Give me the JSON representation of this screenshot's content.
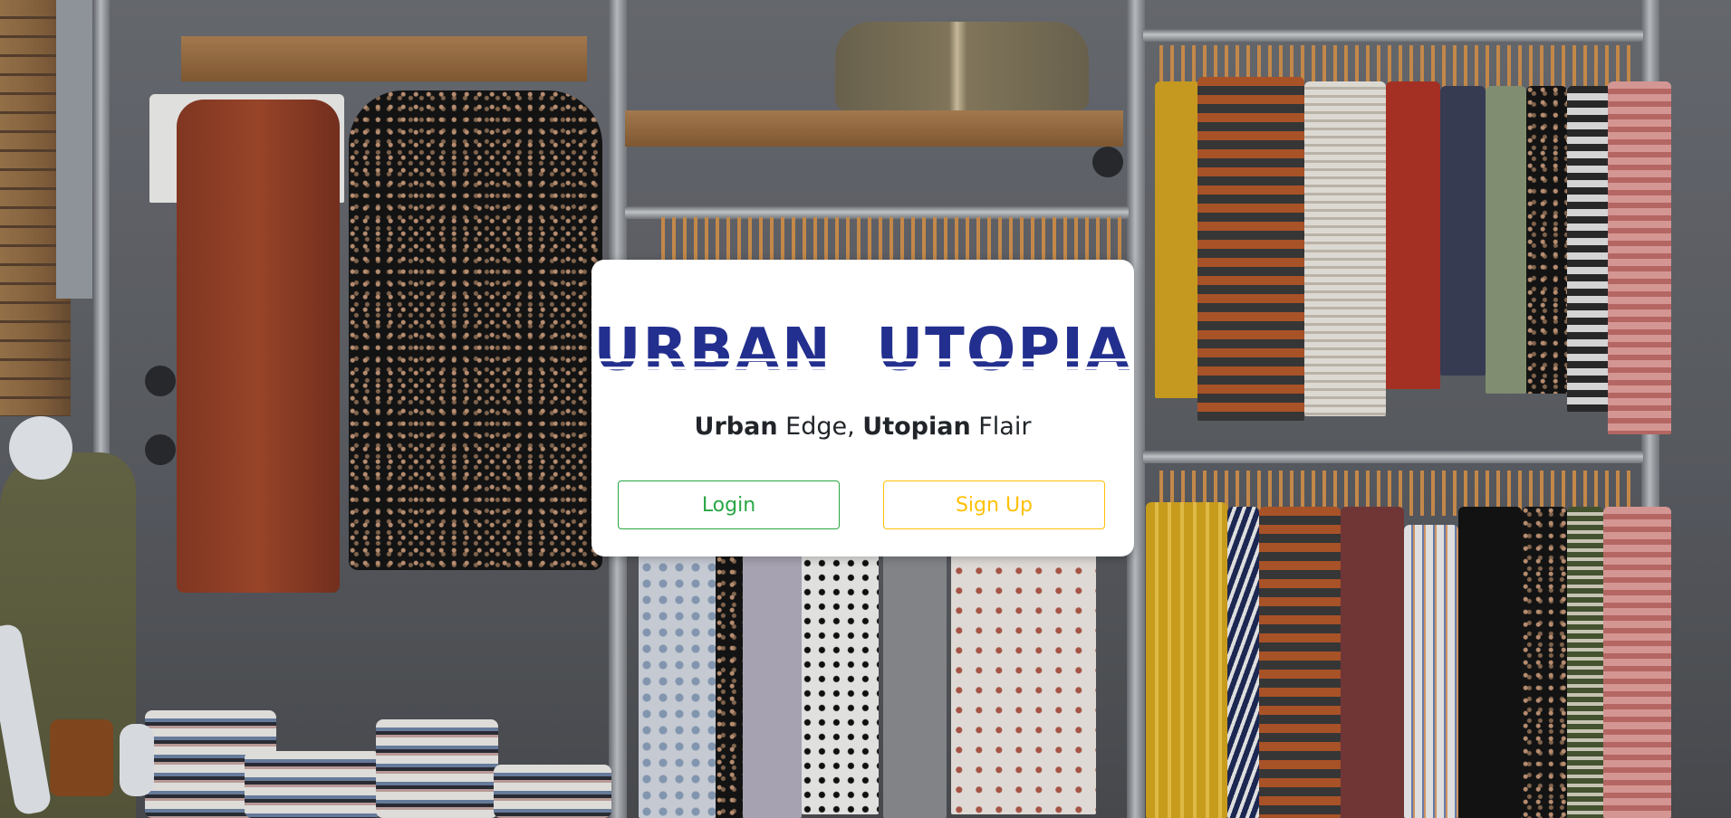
{
  "brand": {
    "logo_word_1": "URBAN",
    "logo_word_2": "UTOPIA",
    "logo_color": "#232f8e"
  },
  "tagline": {
    "bold_1": "Urban",
    "plain_1": " Edge, ",
    "bold_2": "Utopian",
    "plain_2": " Flair"
  },
  "actions": {
    "login_label": "Login",
    "login_color": "#28a745",
    "signup_label": "Sign Up",
    "signup_color": "#ffc107"
  },
  "background": {
    "description_icon": "clothing-store-photo"
  }
}
